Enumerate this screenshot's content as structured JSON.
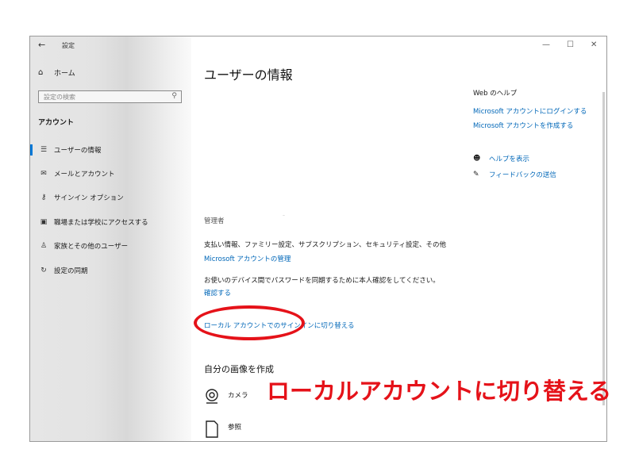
{
  "window": {
    "back": "←",
    "title": "設定",
    "controls": {
      "minimize": "—",
      "maximize": "☐",
      "close": "✕"
    }
  },
  "sidebar": {
    "home_label": "ホーム",
    "search_placeholder": "設定の検索",
    "section": "アカウント",
    "items": [
      {
        "label": "ユーザーの情報",
        "active": true
      },
      {
        "label": "メールとアカウント"
      },
      {
        "label": "サインイン オプション"
      },
      {
        "label": "職場または学校にアクセスする"
      },
      {
        "label": "家族とその他のユーザー"
      },
      {
        "label": "設定の同期"
      }
    ]
  },
  "main": {
    "title": "ユーザーの情報",
    "role": "管理者",
    "billing_text": "支払い情報、ファミリー設定、サブスクリプション、セキュリティ設定、その他",
    "manage_link": "Microsoft アカウントの管理",
    "verify_text": "お使いのデバイス間でパスワードを同期するために本人確認をしてください。",
    "verify_link": "確認する",
    "local_link": "ローカル アカウントでのサインインに切り替える",
    "picture_heading": "自分の画像を作成",
    "camera_label": "カメラ",
    "browse_label": "参照"
  },
  "help": {
    "heading": "Web のヘルプ",
    "links": [
      "Microsoft アカウントにログインする",
      "Microsoft アカウントを作成する"
    ],
    "show_help": "ヘルプを表示",
    "feedback": "フィードバックの送信"
  },
  "annotation": {
    "caption": "ローカルアカウントに切り替える",
    "color": "#e51219"
  }
}
